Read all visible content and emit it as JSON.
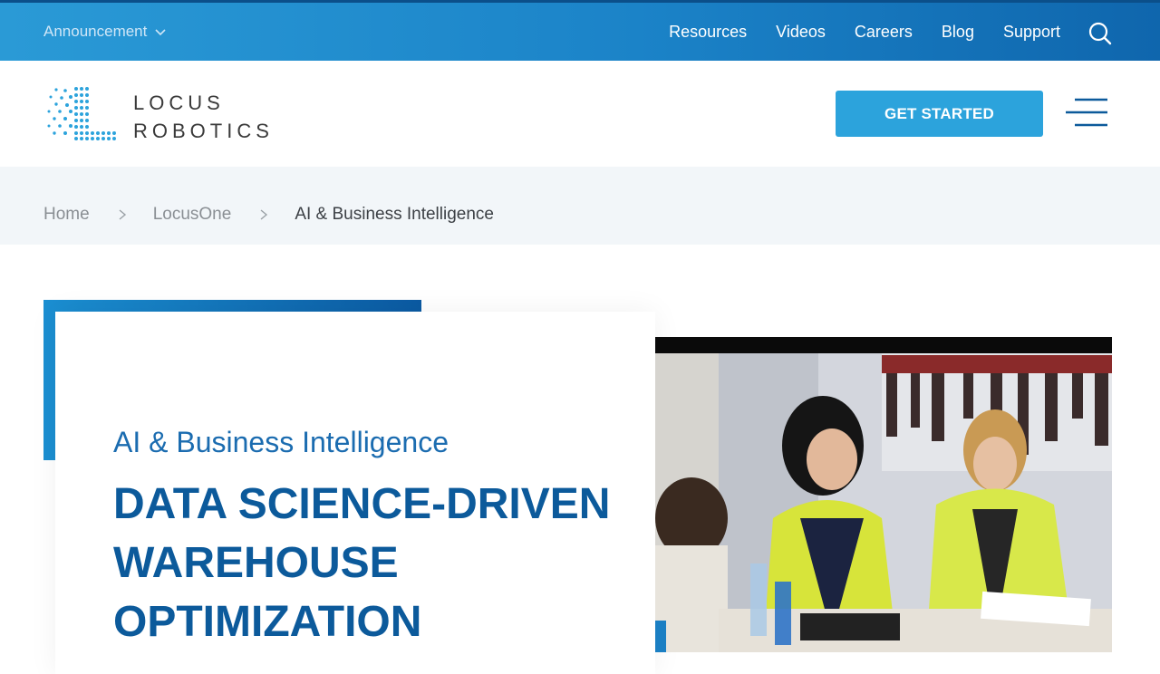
{
  "topbar": {
    "announcement": "Announcement",
    "nav": [
      "Resources",
      "Videos",
      "Careers",
      "Blog",
      "Support"
    ]
  },
  "header": {
    "logo_line1": "LOCUS",
    "logo_line2": "ROBOTICS",
    "cta_label": "GET STARTED"
  },
  "breadcrumb": {
    "items": [
      "Home",
      "LocusOne",
      "AI & Business Intelligence"
    ]
  },
  "hero": {
    "eyebrow": "AI & Business Intelligence",
    "headline": "DATA SCIENCE-DRIVEN WAREHOUSE OPTIMIZATION"
  },
  "colors": {
    "brand_blue": "#0c5a9b",
    "cta_blue": "#2ca3dc",
    "topbar_start": "#2a9ad6",
    "topbar_end": "#0f66ad",
    "breadcrumb_bg": "#f2f6f9"
  },
  "icons": {
    "announcement_chevron": "chevron-down-icon",
    "search": "search-icon",
    "menu": "hamburger-menu-icon",
    "breadcrumb_separator": "chevron-right-icon"
  }
}
